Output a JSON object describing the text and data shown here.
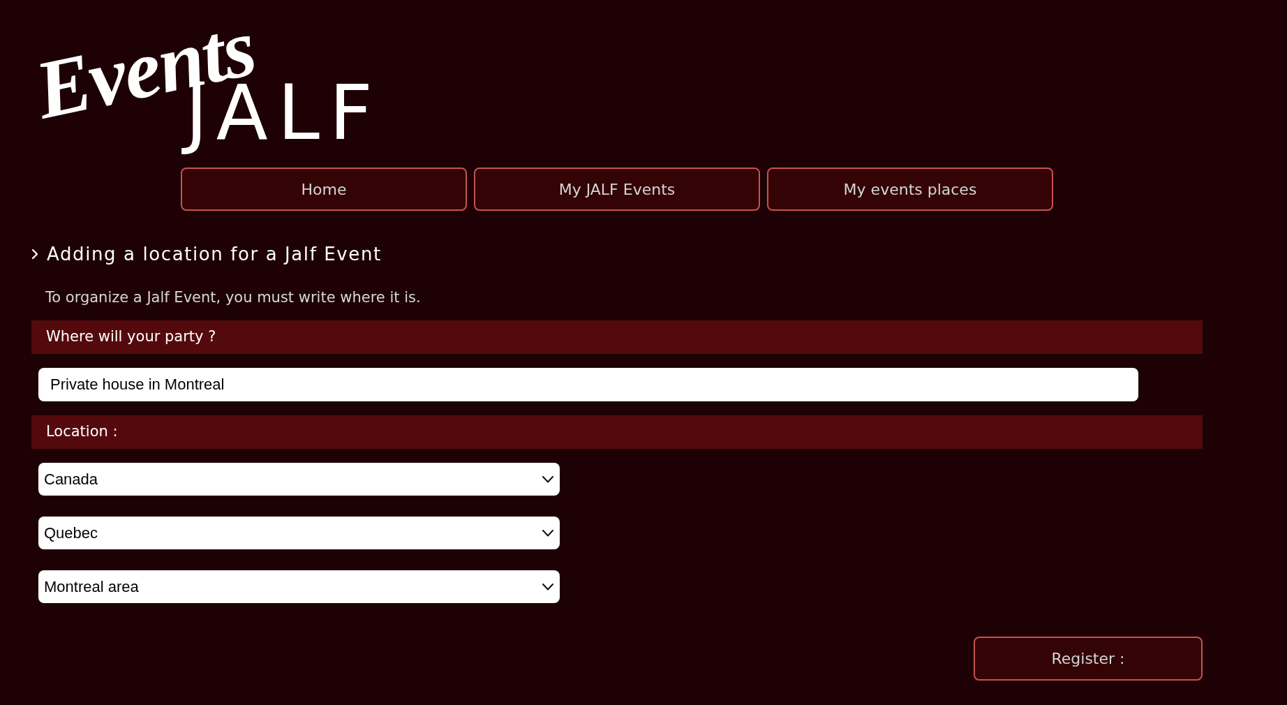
{
  "logo": {
    "script": "Events",
    "wordmark": "JALF"
  },
  "nav": [
    {
      "label": "Home"
    },
    {
      "label": "My JALF Events"
    },
    {
      "label": "My events places"
    }
  ],
  "page": {
    "title": "Adding a location for a Jalf Event",
    "intro": "To organize a Jalf Event, you must write where it is."
  },
  "sections": [
    {
      "heading": "Where will your party ?",
      "kind": "text",
      "fields": [
        {
          "value": "Private house in Montreal"
        }
      ]
    },
    {
      "heading": "Location :",
      "kind": "select",
      "fields": [
        {
          "value": "Canada"
        },
        {
          "value": "Quebec"
        },
        {
          "value": "Montreal area"
        }
      ]
    }
  ],
  "submit": {
    "label": "Register :"
  }
}
